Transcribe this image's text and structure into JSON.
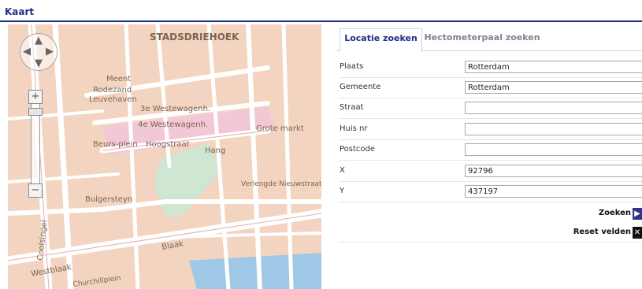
{
  "page": {
    "title": "Kaart"
  },
  "map": {
    "labels": {
      "district": "STADSDRIEHOEK",
      "meent": "Meent",
      "rodezand": "Rodezand",
      "leuvehaven": "Leuvehaven",
      "westewagen3": "3e Westewagenh.",
      "westewagen4": "4e Westewagenh.",
      "hoogstraat": "Hoogstraat",
      "beursplein": "Beurs-plein",
      "coolsingel": "Coolsingel",
      "bulgersteyn": "Bulgersteyn",
      "hang": "Hang",
      "grotemarkt": "Grote markt",
      "verlengde": "Verlengde Nieuwstraat",
      "westblaak": "Westblaak",
      "blaak": "Blaak",
      "churchill": "Churchillplein"
    }
  },
  "panel": {
    "tabs": [
      {
        "label": "Locatie zoeken"
      },
      {
        "label": "Hectometerpaal zoeken"
      }
    ],
    "fields": {
      "plaats": {
        "label": "Plaats",
        "value": "Rotterdam"
      },
      "gemeente": {
        "label": "Gemeente",
        "value": "Rotterdam"
      },
      "straat": {
        "label": "Straat",
        "value": ""
      },
      "huisnr": {
        "label": "Huis nr",
        "value": ""
      },
      "postcode": {
        "label": "Postcode",
        "value": ""
      },
      "x": {
        "label": "X",
        "value": "92796"
      },
      "y": {
        "label": "Y",
        "value": "437197"
      }
    },
    "buttons": {
      "zoeken": {
        "label": "Zoeken",
        "icon": "arrow-right-icon",
        "color": "#2e3585"
      },
      "reset": {
        "label": "Reset velden",
        "icon": "close-icon",
        "color": "#111111"
      }
    }
  },
  "colors": {
    "brand": "#1f2f86",
    "roadFill": "#ffffff",
    "blockFill": "#f3d4c0"
  }
}
